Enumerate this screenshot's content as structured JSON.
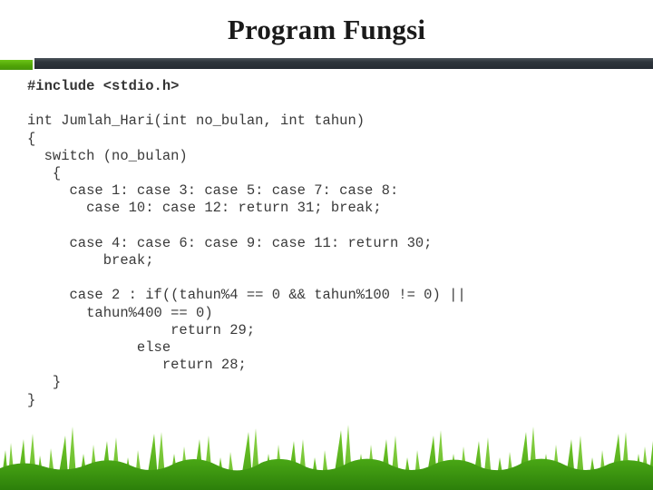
{
  "slide": {
    "title": "Program Fungsi",
    "background_color": "#ffffff"
  },
  "header_rule": {
    "accent_color": "#5faf0c",
    "bar_color": "#2f363d"
  },
  "code": {
    "language": "c",
    "text_color": "#3a3a3a",
    "lines": [
      {
        "text": "#include <stdio.h>",
        "bold": true
      },
      {
        "text": "",
        "bold": false
      },
      {
        "text": "int Jumlah_Hari(int no_bulan, int tahun)",
        "bold": false
      },
      {
        "text": "{",
        "bold": false
      },
      {
        "text": "  switch (no_bulan)",
        "bold": false
      },
      {
        "text": "   {",
        "bold": false
      },
      {
        "text": "     case 1: case 3: case 5: case 7: case 8:",
        "bold": false
      },
      {
        "text": "       case 10: case 12: return 31; break;",
        "bold": false
      },
      {
        "text": "",
        "bold": false
      },
      {
        "text": "     case 4: case 6: case 9: case 11: return 30;",
        "bold": false
      },
      {
        "text": "         break;",
        "bold": false
      },
      {
        "text": "",
        "bold": false
      },
      {
        "text": "     case 2 : if((tahun%4 == 0 && tahun%100 != 0) ||",
        "bold": false
      },
      {
        "text": "       tahun%400 == 0)",
        "bold": false
      },
      {
        "text": "                 return 29;",
        "bold": false
      },
      {
        "text": "             else",
        "bold": false
      },
      {
        "text": "                return 28;",
        "bold": false
      },
      {
        "text": "   }",
        "bold": false
      },
      {
        "text": "}",
        "bold": false
      }
    ]
  },
  "footer": {
    "decoration": "grass-silhouette",
    "grass_light_color": "#5cb81e",
    "grass_mid_color": "#3f9e12",
    "grass_dark_color": "#2e8b0c"
  }
}
